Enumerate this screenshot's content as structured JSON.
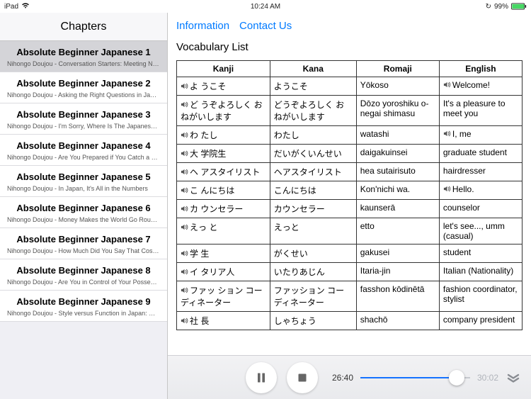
{
  "status": {
    "device": "iPad",
    "time": "10:24 AM",
    "battery_text": "99%"
  },
  "sidebar": {
    "title": "Chapters",
    "items": [
      {
        "title": "Absolute Beginner Japanese 1",
        "subtitle": "Nihongo Doujou - Conversation Starters: Meeting New Peopl...",
        "selected": true
      },
      {
        "title": "Absolute Beginner Japanese 2",
        "subtitle": "Nihongo Doujou - Asking the Right Questions in Japanese!"
      },
      {
        "title": "Absolute Beginner Japanese 3",
        "subtitle": "Nihongo Doujou - I'm Sorry, Where Is The Japanese Food I..."
      },
      {
        "title": "Absolute Beginner Japanese 4",
        "subtitle": "Nihongo Doujou - Are You Prepared if You Catch a Cold in J..."
      },
      {
        "title": "Absolute Beginner Japanese 5",
        "subtitle": "Nihongo Doujou - In Japan, It's All in the Numbers"
      },
      {
        "title": "Absolute Beginner Japanese 6",
        "subtitle": "Nihongo Doujou - Money Makes the World Go Round in Japan"
      },
      {
        "title": "Absolute Beginner Japanese 7",
        "subtitle": "Nihongo Doujou - How Much Did You Say That Costs in Jap..."
      },
      {
        "title": "Absolute Beginner Japanese 8",
        "subtitle": "Nihongo Doujou - Are You in Control of Your Possessions in ..."
      },
      {
        "title": "Absolute Beginner Japanese 9",
        "subtitle": "Nihongo Doujou - Style versus Function in Japan: Whose U..."
      }
    ]
  },
  "topnav": {
    "information": "Information",
    "contact": "Contact Us"
  },
  "page": {
    "title": "Vocabulary List",
    "headers": {
      "kanji": "Kanji",
      "kana": "Kana",
      "romaji": "Romaji",
      "english": "English"
    },
    "rows": [
      {
        "kanji": "よ うこそ",
        "kana": "ようこそ",
        "romaji": "Yōkoso",
        "english": "Welcome!",
        "aKanji": true,
        "aEn": true
      },
      {
        "kanji": "ど うぞよろしく おねがいします",
        "kana": "どうぞよろしく おねがいします",
        "romaji": "Dōzo yoroshiku o-negai shimasu",
        "english": "It's a pleasure to meet you",
        "aKanji": true
      },
      {
        "kanji": "わ たし",
        "kana": "わたし",
        "romaji": "watashi",
        "english": "I, me",
        "aKanji": true,
        "aEn": true
      },
      {
        "kanji": "大 学院生",
        "kana": "だいがくいんせい",
        "romaji": "daigakuinsei",
        "english": "graduate student",
        "aKanji": true
      },
      {
        "kanji": "ヘ アスタイリスト",
        "kana": "ヘアスタイリスト",
        "romaji": "hea sutairisuto",
        "english": "hairdresser",
        "aKanji": true
      },
      {
        "kanji": "こ んにちは",
        "kana": "こんにちは",
        "romaji": "Kon'nichi wa.",
        "english": "Hello.",
        "aKanji": true,
        "aEn": true
      },
      {
        "kanji": "カ ウンセラー",
        "kana": "カウンセラー",
        "romaji": "kaunserā",
        "english": "counselor",
        "aKanji": true
      },
      {
        "kanji": "えっ と",
        "kana": "えっと",
        "romaji": "etto",
        "english": "let's see..., umm (casual)",
        "aKanji": true
      },
      {
        "kanji": "学 生",
        "kana": "がくせい",
        "romaji": "gakusei",
        "english": "student",
        "aKanji": true
      },
      {
        "kanji": "イ タリア人",
        "kana": "いたりあじん",
        "romaji": "Itaria-jin",
        "english": "Italian (Nationality)",
        "aKanji": true
      },
      {
        "kanji": "ファッ ション コーディネーター",
        "kana": "ファッション コーディネーター",
        "romaji": "fasshon kōdinētā",
        "english": "fashion coordinator, stylist",
        "aKanji": true
      },
      {
        "kanji": "社 長",
        "kana": "しゃちょう",
        "romaji": "shachō",
        "english": "company president",
        "aKanji": true
      }
    ]
  },
  "player": {
    "current_time": "26:40",
    "duration": "30:02",
    "progress_pct": 88
  }
}
